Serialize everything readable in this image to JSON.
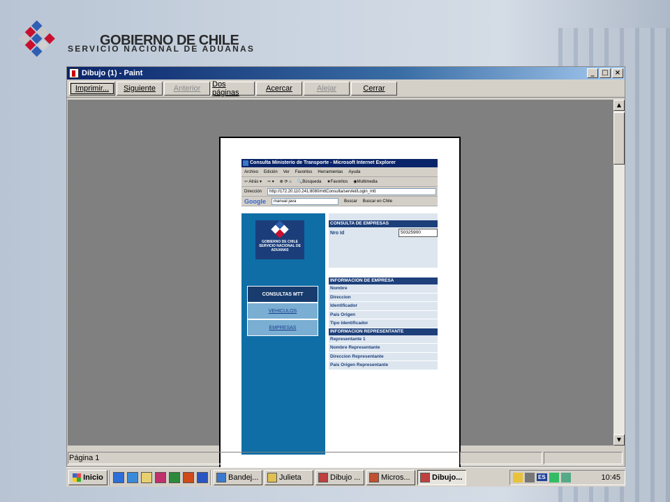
{
  "header": {
    "brand_title": "GOBIERNO DE CHILE",
    "brand_subtitle": "SERVICIO NACIONAL DE ADUANAS"
  },
  "paint_window": {
    "title": "Dibujo (1) - Paint",
    "controls": [
      "_",
      "□",
      "×"
    ],
    "toolbar": [
      {
        "label": "Imprimir...",
        "enabled": true,
        "w": 66
      },
      {
        "label": "Siguiente",
        "enabled": true,
        "w": 66
      },
      {
        "label": "Anterior",
        "enabled": false,
        "w": 66
      },
      {
        "label": "Dos páginas",
        "enabled": true,
        "w": 62
      },
      {
        "label": "Acercar",
        "enabled": true,
        "w": 66
      },
      {
        "label": "Alejar",
        "enabled": false,
        "w": 66
      },
      {
        "label": "Cerrar",
        "enabled": true,
        "w": 66
      }
    ],
    "status": {
      "page": "Página 1"
    }
  },
  "preview": {
    "ie_title": "Consulta Ministerio de Transporte - Microsoft Internet Explorer",
    "menu": [
      "Archivo",
      "Edición",
      "Ver",
      "Favoritos",
      "Herramientas",
      "Ayuda"
    ],
    "toolbar": [
      "Atrás",
      "Búsqueda",
      "Favoritos",
      "Multimedia"
    ],
    "address_label": "Dirección",
    "address": "http://172.20.110.241:8080/mttConsulta/servlet/Login_mtt",
    "google_label": "Google",
    "google_query": "manual java",
    "google_buttons": [
      "Buscar",
      "Buscar en Chile"
    ],
    "logo_text": "GOBIERNO DE CHILE SERVICIO NACIONAL DE ADUANAS",
    "menu_head": "CONSULTAS MTT",
    "menu_links": [
      "VEHICULOS",
      "EMPRESAS"
    ],
    "consulta_header": "CONSULTA DE EMPRESAS",
    "nro_id_label": "Nro Id",
    "nro_id_value": "50325900",
    "info_header": "INFORMACION DE EMPRESA",
    "info_fields": [
      "Nombre",
      "Direccion",
      "Identificador",
      "Pais Origen",
      "Tipo Identificador"
    ],
    "rep_header": "INFORMACION REPRESENTANTE",
    "rep_fields": [
      "Representante 1",
      "Nombre Representante",
      "Direccion Representante",
      "Pais Origen Representante"
    ]
  },
  "taskbar": {
    "start": "Inicio",
    "quick_launch": [
      "ie-icon",
      "outlook-icon",
      "notepad-icon",
      "access-icon",
      "excel-icon",
      "powerpoint-icon",
      "word-icon"
    ],
    "tasks": [
      {
        "label": "Bandej...",
        "w": 70,
        "active": false
      },
      {
        "label": "Julieta",
        "w": 70,
        "active": false
      },
      {
        "label": "Dibujo ...",
        "w": 70,
        "active": false
      },
      {
        "label": "Micros...",
        "w": 70,
        "active": false
      },
      {
        "label": "Dibujo...",
        "w": 70,
        "active": true
      }
    ],
    "language": "ES",
    "clock": "10:45"
  }
}
